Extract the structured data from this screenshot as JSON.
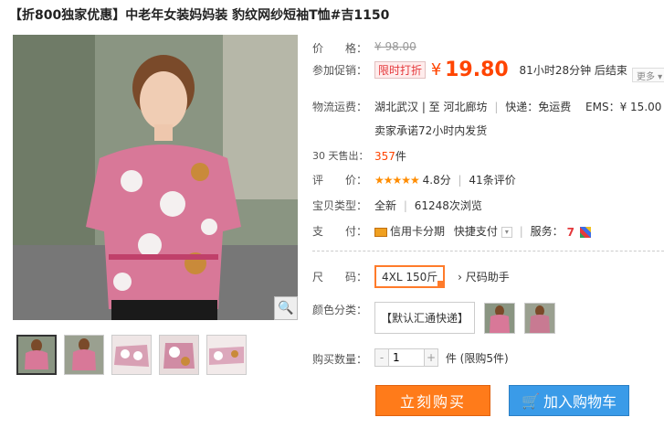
{
  "title": "【折800独家优惠】中老年女装妈妈装 豹纹网纱短袖T恤#吉1150",
  "price": {
    "label": "价　　格：",
    "value": "¥ 98.00"
  },
  "promo": {
    "label": "参加促销：",
    "tag": "限时打折",
    "currency": "¥",
    "price": "19.80",
    "countdown": "81小时28分钟 后结束",
    "more": "更多"
  },
  "shipping": {
    "label": "物流运费：",
    "route": "湖北武汉 | 至  河北廊坊",
    "express": "快递：免运费",
    "ems": "EMS：¥ 15.00",
    "promise": "卖家承诺72小时内发货"
  },
  "sales": {
    "label": "30 天售出：",
    "count": "357",
    "unit": "件"
  },
  "rating": {
    "label": "评　　价：",
    "stars": "★★★★★",
    "score": "4.8分",
    "reviews": "41条评价"
  },
  "type": {
    "label": "宝贝类型：",
    "condition": "全新",
    "views": "61248次浏览"
  },
  "payment": {
    "label": "支　　付：",
    "card": "信用卡分期",
    "quick": "快捷支付",
    "service_label": "服务："
  },
  "size": {
    "label": "尺　　码：",
    "selected": "4XL 150斤",
    "helper": "尺码助手"
  },
  "color": {
    "label": "颜色分类：",
    "option_text": "【默认汇通快递】"
  },
  "quantity": {
    "label": "购买数量：",
    "value": "1",
    "minus": "-",
    "plus": "+",
    "unit": "件 (限购5件)"
  },
  "buttons": {
    "buy": "立刻购买",
    "cart": "加入购物车"
  },
  "colors": {
    "accent": "#ff4400",
    "buy_bg": "#ff7b1a",
    "cart_bg": "#3a9be8"
  },
  "icons": {
    "zoom": "magnifier-icon",
    "cart": "cart-icon",
    "arrow": "chevron-right-icon"
  }
}
